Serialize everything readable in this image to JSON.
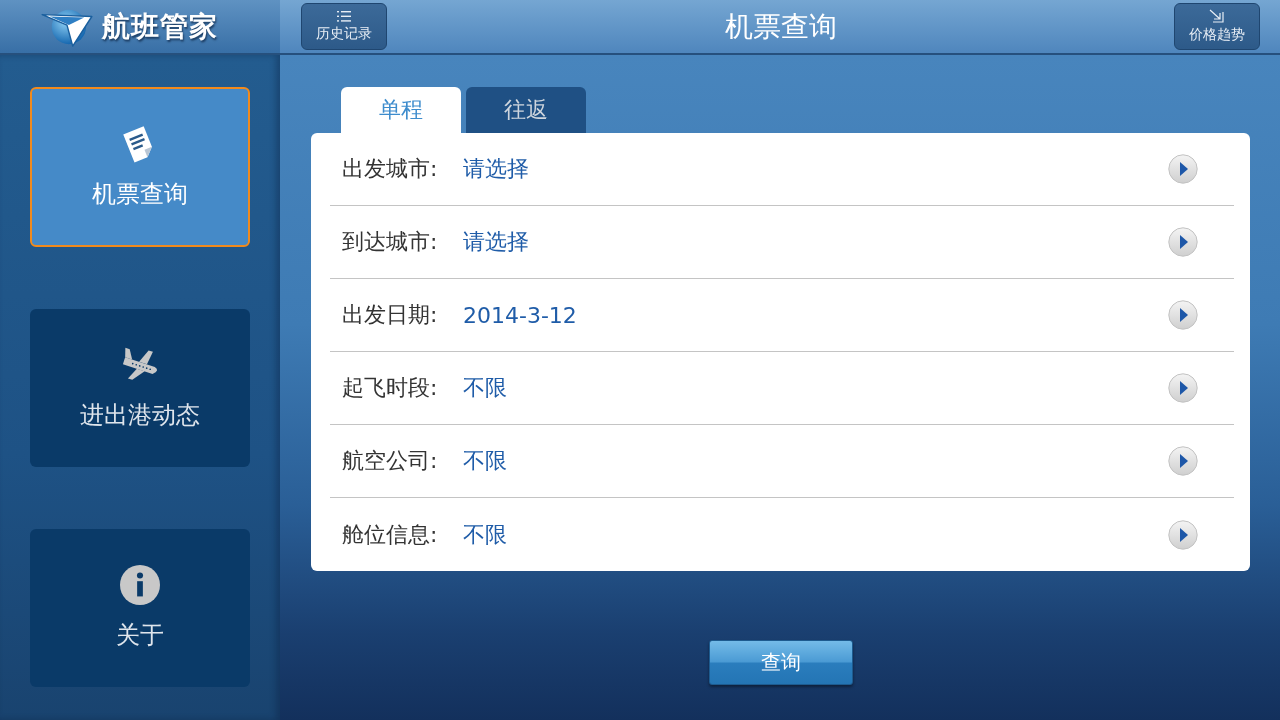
{
  "header": {
    "app_name": "航班管家",
    "history_button": "历史记录",
    "title": "机票查询",
    "trend_button": "价格趋势"
  },
  "sidebar": {
    "items": [
      {
        "label": "机票查询",
        "selected": true
      },
      {
        "label": "进出港动态",
        "selected": false
      },
      {
        "label": "关于",
        "selected": false
      }
    ]
  },
  "tabs": [
    {
      "label": "单程",
      "selected": true
    },
    {
      "label": "往返",
      "selected": false
    }
  ],
  "form": {
    "rows": [
      {
        "label": "出发城市:",
        "value": "请选择"
      },
      {
        "label": "到达城市:",
        "value": "请选择"
      },
      {
        "label": "出发日期:",
        "value": "2014-3-12"
      },
      {
        "label": "起飞时段:",
        "value": "不限"
      },
      {
        "label": "航空公司:",
        "value": "不限"
      },
      {
        "label": "舱位信息:",
        "value": "不限"
      }
    ]
  },
  "search_button": "查询"
}
